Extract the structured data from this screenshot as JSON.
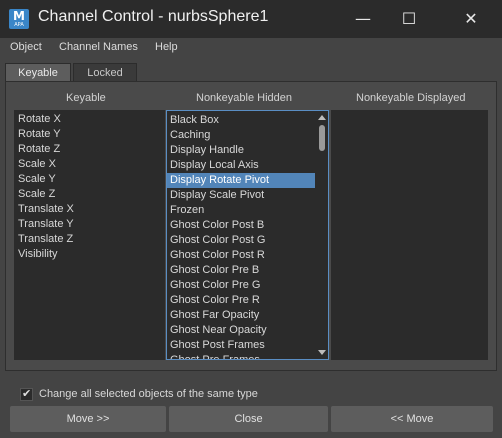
{
  "window": {
    "app_icon_letter": "M",
    "app_icon_sub": "APA",
    "title": "Channel Control - nurbsSphere1",
    "minimize_glyph": "—",
    "maximize_glyph": "☐",
    "close_glyph": "✕"
  },
  "menu": [
    "Object",
    "Channel Names",
    "Help"
  ],
  "tabs": [
    "Keyable",
    "Locked"
  ],
  "columns": {
    "keyable": "Keyable",
    "nonkeyable_hidden": "Nonkeyable Hidden",
    "nonkeyable_displayed": "Nonkeyable Displayed"
  },
  "keyable_items": [
    "Rotate X",
    "Rotate Y",
    "Rotate Z",
    "Scale X",
    "Scale Y",
    "Scale Z",
    "Translate X",
    "Translate Y",
    "Translate Z",
    "Visibility"
  ],
  "hidden_items": [
    "Black Box",
    "Caching",
    "Display Handle",
    "Display Local Axis",
    "Display Rotate Pivot",
    "Display Scale Pivot",
    "Frozen",
    "Ghost Color Post B",
    "Ghost Color Post G",
    "Ghost Color Post R",
    "Ghost Color Pre B",
    "Ghost Color Pre G",
    "Ghost Color Pre R",
    "Ghost Far Opacity",
    "Ghost Near Opacity",
    "Ghost Post Frames",
    "Ghost Pre Frames"
  ],
  "hidden_selected": "Display Rotate Pivot",
  "displayed_items": [],
  "option": {
    "checked": true,
    "label": "Change all selected objects of the same type"
  },
  "buttons": {
    "move_right": "Move >>",
    "close": "Close",
    "move_left": "<< Move"
  },
  "colors": {
    "selection": "#5285b9",
    "list_bg": "#2b2b2b",
    "window_bg": "#444444"
  }
}
